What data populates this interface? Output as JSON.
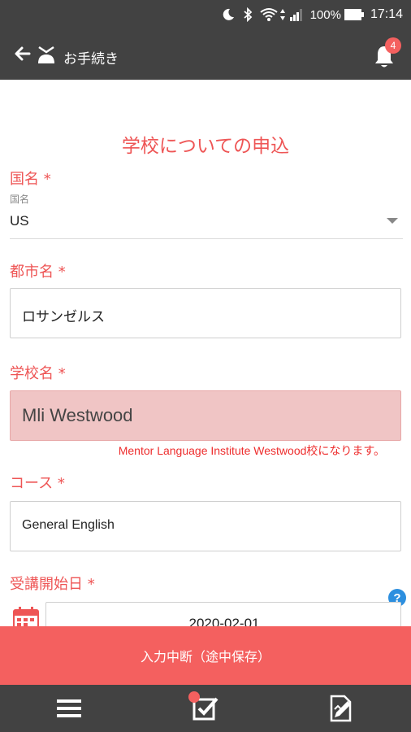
{
  "status_bar": {
    "battery_percent": "100%",
    "time": "17:14",
    "icons": [
      "moon-icon",
      "bluetooth-icon",
      "wifi-icon",
      "data-arrows-icon",
      "signal-icon",
      "battery-icon"
    ]
  },
  "app_bar": {
    "title": "お手続き",
    "notification_count": "4",
    "icons": [
      "back-arrow-icon",
      "app-logo-icon",
      "bell-icon"
    ]
  },
  "form": {
    "title": "学校についての申込",
    "country": {
      "label": "国名 *",
      "small_label": "国名",
      "value": "US"
    },
    "city": {
      "label": "都市名 *",
      "value": "ロサンゼルス"
    },
    "school": {
      "label": "学校名 *",
      "value": "Mli Westwood",
      "helper": "Mentor Language Institute Westwood校になります。"
    },
    "course": {
      "label": "コース *",
      "value": "General English"
    },
    "start_date": {
      "label": "受講開始日 *",
      "value": "2020-02-01"
    }
  },
  "suspend_button": {
    "label": "入力中断（途中保存）"
  },
  "bottom_nav": {
    "items": [
      "menu-icon",
      "checklist-icon",
      "document-edit-icon"
    ]
  },
  "colors": {
    "accent": "#f4605f",
    "label_red": "#ee5555",
    "error_bg": "#f0c5c5",
    "bar_dark": "#424242",
    "help_blue": "#2d8fdf"
  }
}
